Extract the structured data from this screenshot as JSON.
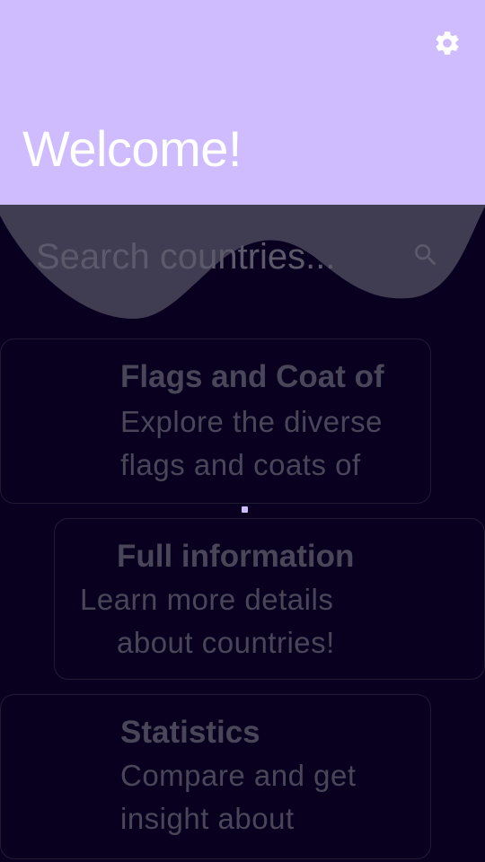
{
  "header": {
    "title": "Welcome!",
    "settings_icon": "gear-icon",
    "background_color": "#cfbcff"
  },
  "search": {
    "placeholder": "Search countries...",
    "value": "",
    "icon": "search-icon"
  },
  "cards": [
    {
      "title": "Flags and Coat of",
      "description_lines": [
        "Explore the diverse",
        "flags and coats of"
      ]
    },
    {
      "title": "Full information",
      "description_lines": [
        "Learn more details",
        "about countries!"
      ]
    },
    {
      "title": "Statistics",
      "description_lines": [
        "Compare and get",
        "insight about"
      ]
    }
  ],
  "colors": {
    "background": "#090020",
    "accent": "#cfbcff",
    "card_text": "#4a4659"
  }
}
